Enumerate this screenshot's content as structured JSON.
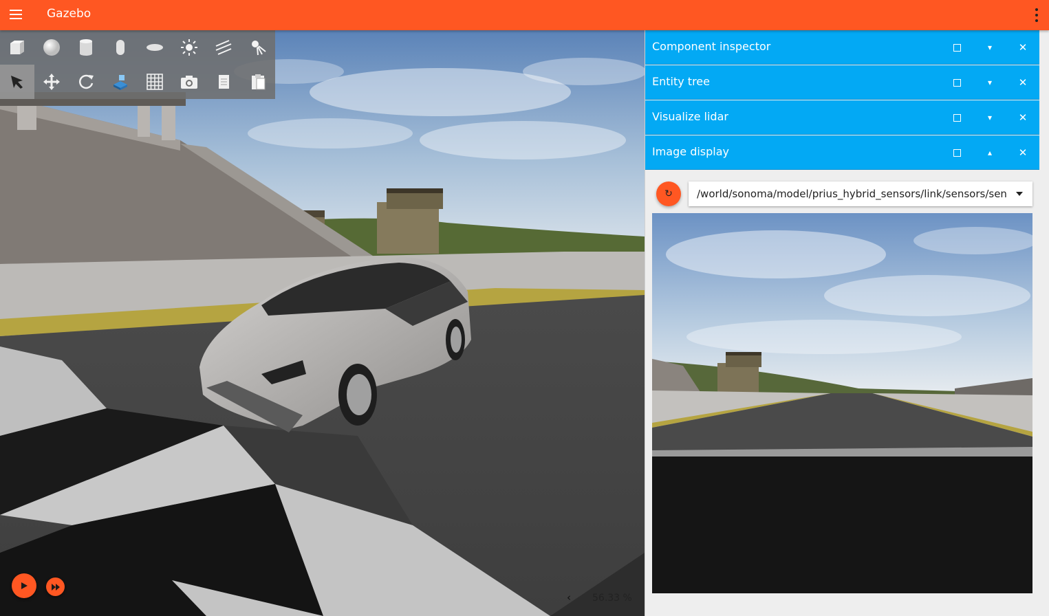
{
  "app": {
    "title": "Gazebo",
    "accent_color": "#ff5722",
    "panel_header_color": "#03a9f4"
  },
  "toolbar": {
    "row1": [
      {
        "name": "box-icon",
        "tooltip": "Box"
      },
      {
        "name": "sphere-icon",
        "tooltip": "Sphere"
      },
      {
        "name": "cylinder-icon",
        "tooltip": "Cylinder"
      },
      {
        "name": "capsule-icon",
        "tooltip": "Capsule"
      },
      {
        "name": "ellipsoid-icon",
        "tooltip": "Ellipsoid"
      },
      {
        "name": "point-light-icon",
        "tooltip": "Point light"
      },
      {
        "name": "directional-light-icon",
        "tooltip": "Directional light"
      },
      {
        "name": "spot-light-icon",
        "tooltip": "Spot light"
      }
    ],
    "row2": [
      {
        "name": "select-arrow-icon",
        "tooltip": "Select mode",
        "active": true
      },
      {
        "name": "translate-icon",
        "tooltip": "Translate mode"
      },
      {
        "name": "rotate-icon",
        "tooltip": "Rotate mode"
      },
      {
        "name": "fuel-resource-icon",
        "tooltip": "Resource spawner"
      },
      {
        "name": "grid-snap-icon",
        "tooltip": "Grid"
      },
      {
        "name": "screenshot-camera-icon",
        "tooltip": "Screenshot"
      },
      {
        "name": "copy-icon",
        "tooltip": "Copy"
      },
      {
        "name": "paste-icon",
        "tooltip": "Paste"
      }
    ]
  },
  "playback": {
    "real_time_factor": "56.33 %",
    "expand_glyph": "‹"
  },
  "panels": [
    {
      "title": "Component inspector",
      "collapse_glyph": "▾"
    },
    {
      "title": "Entity tree",
      "collapse_glyph": "▾"
    },
    {
      "title": "Visualize lidar",
      "collapse_glyph": "▾"
    },
    {
      "title": "Image display",
      "collapse_glyph": "▴"
    }
  ],
  "image_display": {
    "refresh_glyph": "↻",
    "topic": "/world/sonoma/model/prius_hybrid_sensors/link/sensors/sensor/front_camera_sensor/image"
  }
}
